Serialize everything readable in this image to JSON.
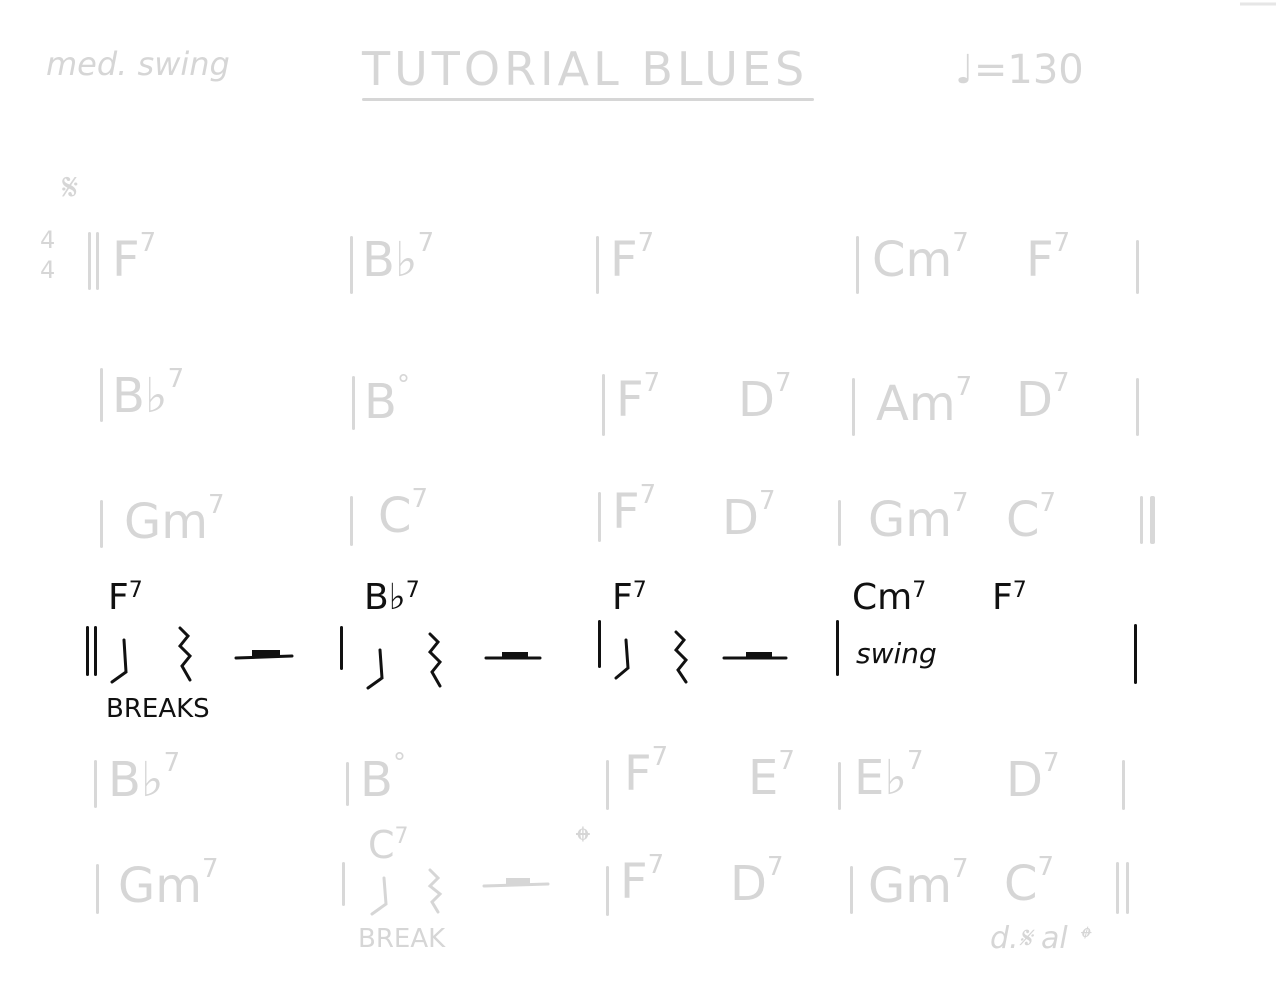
{
  "header": {
    "style": "med. swing",
    "title": "TUTORIAL BLUES",
    "tempo": "♩=130"
  },
  "signs": {
    "segno": "𝄋",
    "time_top": "4",
    "time_bottom": "4",
    "coda": "𝄌",
    "ds_al_coda": "d.𝄋 al 𝄌"
  },
  "rows": [
    {
      "chords": [
        "F",
        "B♭",
        "F",
        "Cm",
        "F"
      ],
      "exts": [
        "7",
        "7",
        "7",
        "7",
        "7"
      ]
    },
    {
      "chords": [
        "B♭",
        "B",
        "F",
        "D",
        "Am",
        "D"
      ],
      "exts": [
        "7",
        "°",
        "7",
        "7",
        "7",
        "7"
      ]
    },
    {
      "chords": [
        "Gm",
        "C",
        "F",
        "D",
        "Gm",
        "C"
      ],
      "exts": [
        "7",
        "7",
        "7",
        "7",
        "7",
        "7"
      ]
    },
    {
      "chords": [
        "F",
        "B♭",
        "F",
        "Cm",
        "F"
      ],
      "exts": [
        "7",
        "7",
        "7",
        "7",
        "7"
      ]
    },
    {
      "chords": [
        "B♭",
        "B",
        "F",
        "E",
        "E♭",
        "D"
      ],
      "exts": [
        "7",
        "°",
        "7",
        "7",
        "7",
        "7"
      ]
    },
    {
      "chords": [
        "C",
        "Gm",
        "F",
        "D",
        "Gm",
        "C"
      ],
      "exts": [
        "7",
        "7",
        "7",
        "7",
        "7",
        "7"
      ]
    }
  ],
  "annotations": {
    "breaks": "BREAKS",
    "swing": "swing",
    "break": "BREAK"
  },
  "colors": {
    "faded_ink": "#d6d6d6",
    "dark_ink": "#111111"
  }
}
